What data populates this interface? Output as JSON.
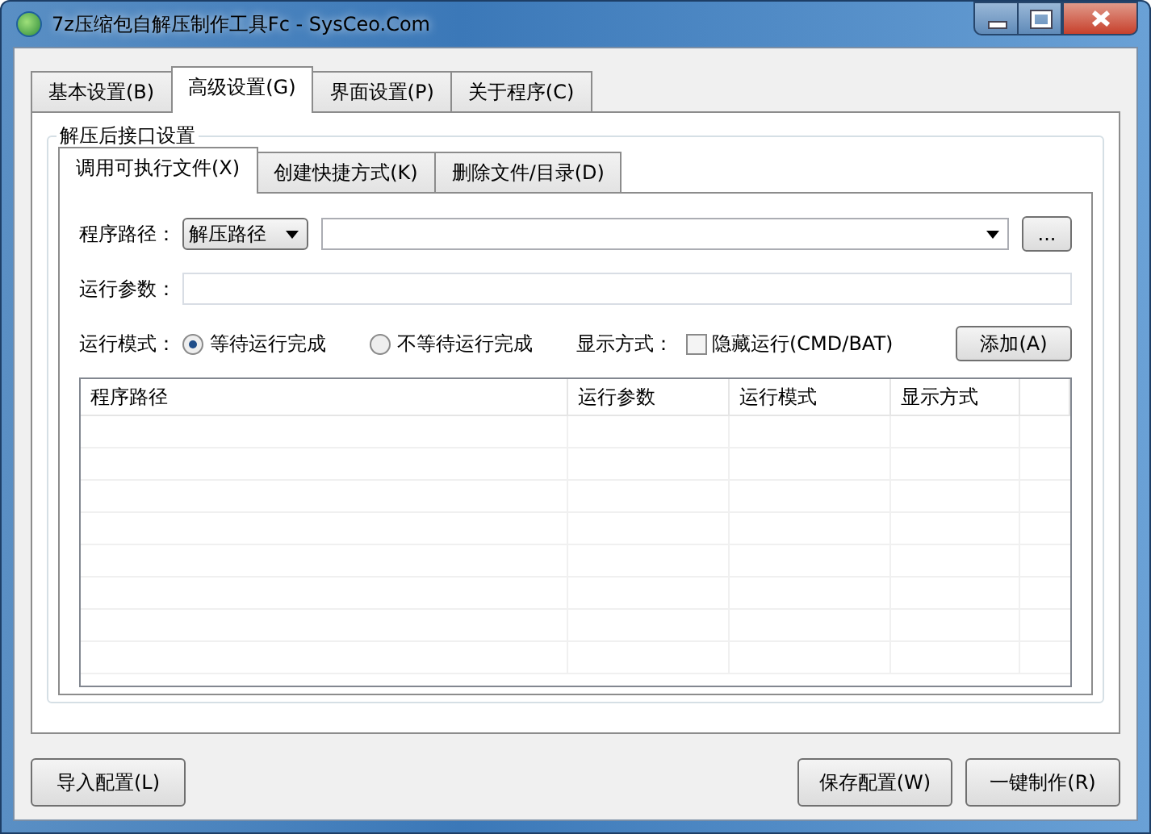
{
  "window": {
    "title": "7z压缩包自解压制作工具Fc - SysCeo.Com"
  },
  "tabs": [
    {
      "label": "基本设置(B)",
      "selected": false
    },
    {
      "label": "高级设置(G)",
      "selected": true
    },
    {
      "label": "界面设置(P)",
      "selected": false
    },
    {
      "label": "关于程序(C)",
      "selected": false
    }
  ],
  "group": {
    "title": "解压后接口设置"
  },
  "sub_tabs": [
    {
      "label": "调用可执行文件(X)",
      "selected": true
    },
    {
      "label": "创建快捷方式(K)",
      "selected": false
    },
    {
      "label": "删除文件/目录(D)",
      "selected": false
    }
  ],
  "form": {
    "path_label": "程序路径：",
    "path_type": "解压路径",
    "browse": "...",
    "args_label": "运行参数：",
    "mode_label": "运行模式：",
    "mode_options": [
      {
        "label": "等待运行完成",
        "selected": true
      },
      {
        "label": "不等待运行完成",
        "selected": false
      }
    ],
    "display_label": "显示方式：",
    "hide_run": {
      "label": "隐藏运行(CMD/BAT)",
      "checked": false
    },
    "add_button": "添加(A)"
  },
  "table": {
    "columns": [
      "程序路径",
      "运行参数",
      "运行模式",
      "显示方式"
    ]
  },
  "buttons_left": [
    "导入配置(L)"
  ],
  "buttons_right": [
    "保存配置(W)",
    "一键制作(R)"
  ]
}
